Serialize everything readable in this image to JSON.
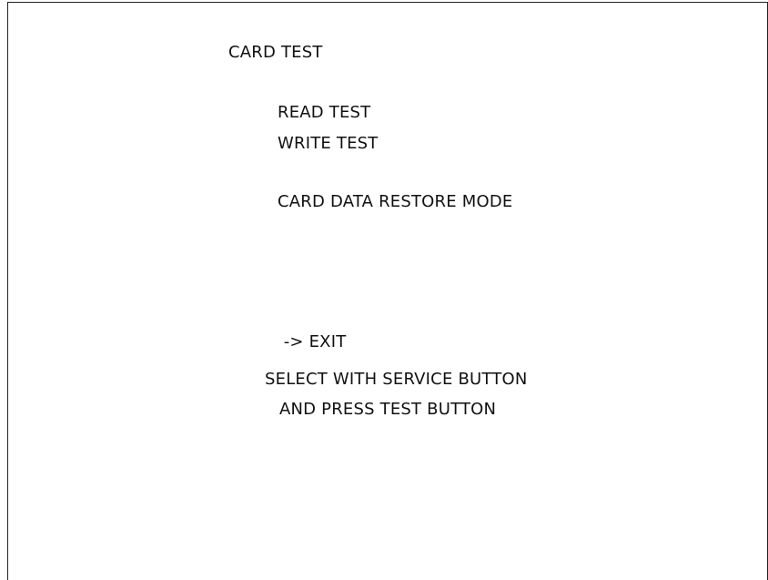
{
  "screen": {
    "title": "CARD TEST",
    "menu": {
      "read_test": "READ TEST",
      "write_test": "WRITE TEST",
      "restore_mode": "CARD DATA RESTORE MODE",
      "cursor": "-> ",
      "exit": "EXIT"
    },
    "instructions": {
      "line1": "SELECT WITH SERVICE BUTTON",
      "line2": "AND PRESS TEST BUTTON"
    }
  },
  "colors": {
    "background": "#ffffff",
    "text": "#111111",
    "frame": "#222222"
  }
}
